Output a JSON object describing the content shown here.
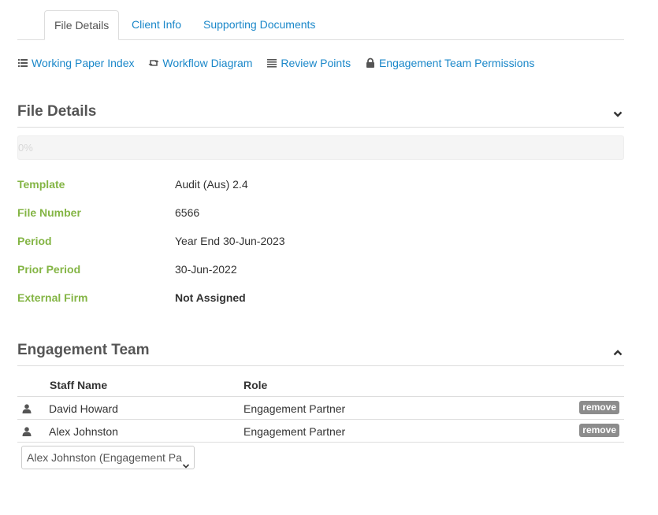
{
  "tabs": [
    {
      "label": "File Details",
      "active": true
    },
    {
      "label": "Client Info",
      "active": false
    },
    {
      "label": "Supporting Documents",
      "active": false
    }
  ],
  "links": {
    "working_paper_index": "Working Paper Index",
    "workflow_diagram": "Workflow Diagram",
    "review_points": "Review Points",
    "team_permissions": "Engagement Team Permissions"
  },
  "file_details": {
    "title": "File Details",
    "progress_text": "0%",
    "progress": 0,
    "rows": [
      {
        "label": "Template",
        "value": "Audit (Aus) 2.4"
      },
      {
        "label": "File Number",
        "value": "6566"
      },
      {
        "label": "Period",
        "value": "Year End 30-Jun-2023"
      },
      {
        "label": "Prior Period",
        "value": "30-Jun-2022"
      },
      {
        "label": "External Firm",
        "value": "Not Assigned"
      }
    ]
  },
  "engagement_team": {
    "title": "Engagement Team",
    "columns": {
      "staff_name": "Staff Name",
      "role": "Role"
    },
    "members": [
      {
        "name": "David Howard",
        "role": "Engagement Partner",
        "action": "remove"
      },
      {
        "name": "Alex Johnston",
        "role": "Engagement Partner",
        "action": "remove"
      }
    ],
    "select_value": "Alex Johnston (Engagement Pa"
  },
  "colors": {
    "link": "#1a87c9",
    "label_green": "#84b545",
    "remove_badge": "#8c8c8c"
  }
}
